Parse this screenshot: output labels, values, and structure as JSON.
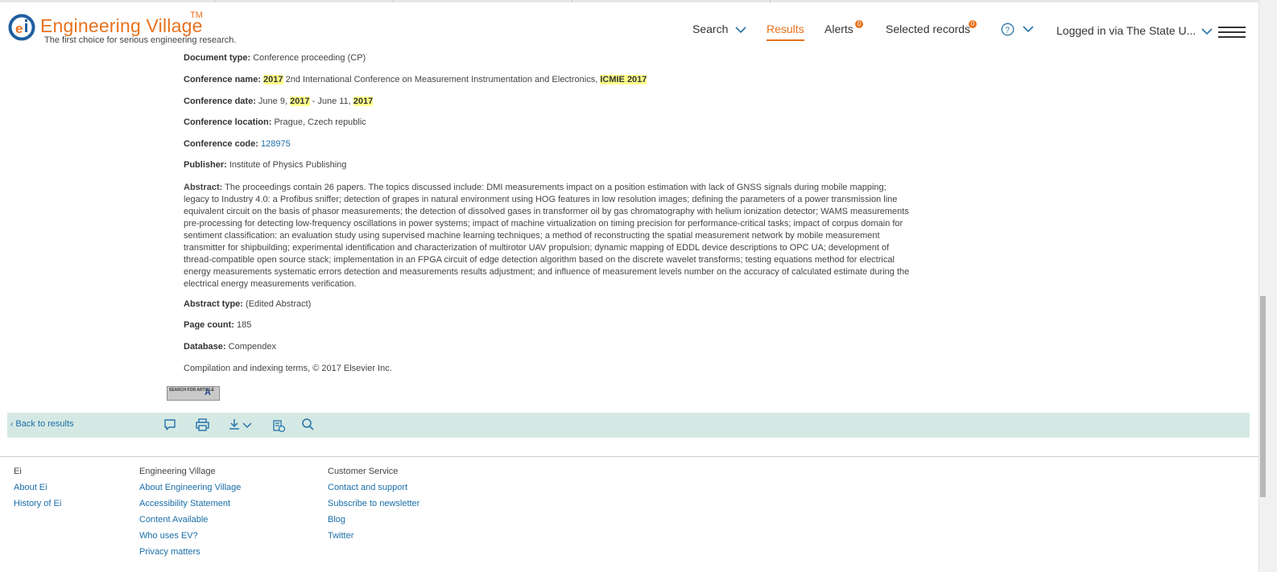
{
  "header": {
    "brand": "Engineering Village",
    "trademark": "TM",
    "tagline": "The first choice for serious engineering research.",
    "nav": {
      "search": "Search",
      "results": "Results",
      "alerts": "Alerts",
      "alerts_count": "0",
      "selected_records": "Selected records",
      "selected_count": "0",
      "help_icon": "?",
      "login": "Logged in via The State U..."
    }
  },
  "record": {
    "doc_type_label": "Document type:",
    "doc_type_value": "Conference proceeding (CP)",
    "conf_name_label": "Conference name:",
    "conf_name_year": "2017",
    "conf_name_text": "2nd International Conference on Measurement Instrumentation and Electronics,",
    "conf_name_acronym": "ICMIE 2017",
    "conf_date_label": "Conference date:",
    "conf_date_start": "June 9,",
    "conf_date_year1": "2017",
    "conf_date_sep": "- June 11,",
    "conf_date_year2": "2017",
    "conf_location_label": "Conference location:",
    "conf_location_value": "Prague, Czech republic",
    "conf_code_label": "Conference code:",
    "conf_code_value": "128975",
    "publisher_label": "Publisher:",
    "publisher_value": "Institute of Physics Publishing",
    "abstract_label": "Abstract:",
    "abstract_text": "The proceedings contain 26 papers. The topics discussed include: DMI measurements impact on a position estimation with lack of GNSS signals during mobile mapping; legacy to Industry 4.0: a Profibus sniffer; detection of grapes in natural environment using HOG features in low resolution images; defining the parameters of a power transmission line equivalent circuit on the basis of phasor measurements; the detection of dissolved gases in transformer oil by gas chromatography with helium ionization detector; WAMS measurements pre-processing for detecting low-frequency oscillations in power systems; impact of machine virtualization on timing precision for performance-critical tasks; impact of corpus domain for sentiment classification: an evaluation study using supervised machine learning techniques; a method of reconstructing the spatial measurement network by mobile measurement transmitter for shipbuilding; experimental identification and characterization of multirotor UAV propulsion; dynamic mapping of EDDL device descriptions to OPC UA; development of thread-compatible open source stack; implementation in an FPGA circuit of edge detection algorithm based on the discrete wavelet transforms; testing equations method for electrical energy measurements systematic errors detection and measurements results adjustment; and influence of measurement levels number on the accuracy of calculated estimate during the electrical energy measurements verification.",
    "abstract_type_label": "Abstract type:",
    "abstract_type_value": "(Edited Abstract)",
    "page_count_label": "Page count:",
    "page_count_value": "185",
    "database_label": "Database:",
    "database_value": "Compendex",
    "copyright": "Compilation and indexing terms, © 2017 Elsevier Inc.",
    "sfx_text": "SEARCH FOR ARTICLE",
    "sfx_letters": "A"
  },
  "toolbar": {
    "back": "Back to results",
    "icons": [
      "comment-icon",
      "print-icon",
      "download-icon",
      "bibliography-icon",
      "search-icon"
    ]
  },
  "footer": {
    "col1": {
      "heading": "Ei",
      "links": [
        "About Ei",
        "History of Ei"
      ]
    },
    "col2": {
      "heading": "Engineering Village",
      "links": [
        "About Engineering Village",
        "Accessibility Statement",
        "Content Available",
        "Who uses EV?",
        "Privacy matters"
      ]
    },
    "col3": {
      "heading": "Customer Service",
      "links": [
        "Contact and support",
        "Subscribe to newsletter",
        "Blog",
        "Twitter"
      ]
    }
  },
  "colors": {
    "brand_orange": "#e9711c",
    "link_blue": "#1a6ea8",
    "highlight": "#ffff8c",
    "toolbar_bg": "#d5e9e4"
  }
}
